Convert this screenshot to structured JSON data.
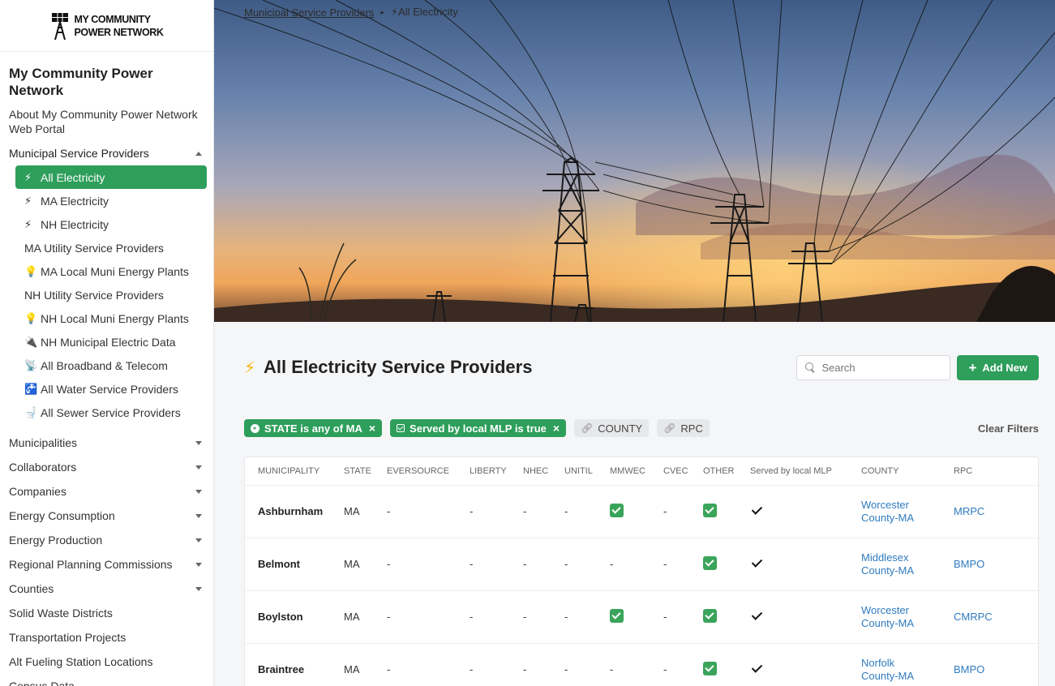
{
  "brand": {
    "logo_line1": "MY COMMUNITY",
    "logo_line2": "POWER NETWORK"
  },
  "sidebar": {
    "site_title": "My Community Power Network",
    "about": "About My Community Power Network Web Portal",
    "section": "Municipal Service Providers",
    "sub_items": [
      {
        "icon": "⚡",
        "label": "All Electricity"
      },
      {
        "icon": "⚡",
        "label": "MA Electricity"
      },
      {
        "icon": "⚡",
        "label": "NH Electricity"
      },
      {
        "icon": "",
        "label": "MA Utility Service Providers"
      },
      {
        "icon": "💡",
        "label": "MA Local Muni Energy Plants"
      },
      {
        "icon": "",
        "label": "NH Utility Service Providers"
      },
      {
        "icon": "💡",
        "label": "NH Local Muni Energy Plants"
      },
      {
        "icon": "🔌",
        "label": "NH Municipal Electric Data"
      },
      {
        "icon": "📡",
        "label": "All Broadband & Telecom"
      },
      {
        "icon": "🚰",
        "label": "All Water Service Providers"
      },
      {
        "icon": "🚽",
        "label": "All Sewer Service Providers"
      }
    ],
    "nav": [
      {
        "label": "Municipalities"
      },
      {
        "label": "Collaborators"
      },
      {
        "label": "Companies"
      },
      {
        "label": "Energy Consumption"
      },
      {
        "label": "Energy Production"
      },
      {
        "label": "Regional Planning Commissions"
      },
      {
        "label": "Counties"
      },
      {
        "label": "Solid Waste Districts"
      },
      {
        "label": "Transportation Projects"
      },
      {
        "label": "Alt Fueling Station Locations"
      },
      {
        "label": "Census Data"
      }
    ]
  },
  "breadcrumb": {
    "parent": "Municipal Service Providers",
    "current": "⚡All Electricity"
  },
  "page": {
    "title_icon": "⚡",
    "title": "All Electricity Service Providers"
  },
  "search": {
    "placeholder": "Search",
    "value": ""
  },
  "add_button": "Add New",
  "filters": {
    "chips": [
      "STATE is any of MA",
      "Served by local MLP is true",
      "COUNTY",
      "RPC"
    ],
    "clear": "Clear Filters"
  },
  "table": {
    "columns": [
      "MUNICIPALITY",
      "STATE",
      "EVERSOURCE",
      "LIBERTY",
      "NHEC",
      "UNITIL",
      "MMWEC",
      "CVEC",
      "OTHER",
      "Served by local MLP",
      "COUNTY",
      "RPC"
    ],
    "rows": [
      {
        "municipality": "Ashburnham",
        "state": "MA",
        "eversource": "-",
        "liberty": "-",
        "nhec": "-",
        "unitil": "-",
        "mmwec": "check",
        "cvec": "-",
        "other": "check",
        "mlp": true,
        "county_l1": "Worcester",
        "county_l2": "County-MA",
        "rpc": "MRPC"
      },
      {
        "municipality": "Belmont",
        "state": "MA",
        "eversource": "-",
        "liberty": "-",
        "nhec": "-",
        "unitil": "-",
        "mmwec": "-",
        "cvec": "-",
        "other": "check",
        "mlp": true,
        "county_l1": "Middlesex",
        "county_l2": "County-MA",
        "rpc": "BMPO"
      },
      {
        "municipality": "Boylston",
        "state": "MA",
        "eversource": "-",
        "liberty": "-",
        "nhec": "-",
        "unitil": "-",
        "mmwec": "check",
        "cvec": "-",
        "other": "check",
        "mlp": true,
        "county_l1": "Worcester",
        "county_l2": "County-MA",
        "rpc": "CMRPC"
      },
      {
        "municipality": "Braintree",
        "state": "MA",
        "eversource": "-",
        "liberty": "-",
        "nhec": "-",
        "unitil": "-",
        "mmwec": "-",
        "cvec": "-",
        "other": "check",
        "mlp": true,
        "county_l1": "Norfolk",
        "county_l2": "County-MA",
        "rpc": "BMPO"
      }
    ]
  },
  "colors": {
    "accent": "#2e9e5b",
    "link": "#2f7bbf",
    "check": "#3aa55a"
  }
}
